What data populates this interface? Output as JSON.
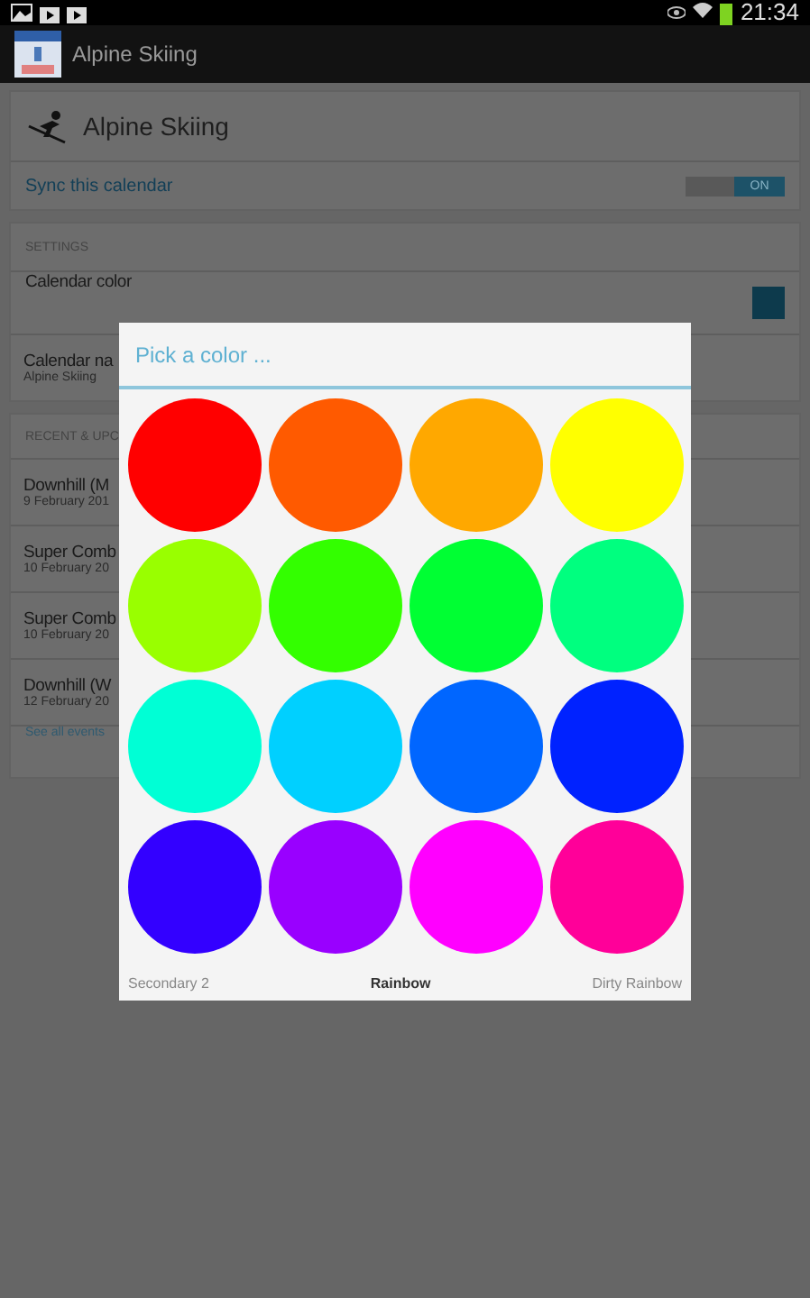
{
  "status_bar": {
    "time": "21:34"
  },
  "action_bar": {
    "title": "Alpine Skiing"
  },
  "calendar_card": {
    "title": "Alpine Skiing",
    "sync_label": "Sync this calendar",
    "sync_toggle": {
      "label": "ON",
      "on": true
    }
  },
  "settings": {
    "header": "SETTINGS",
    "color_label": "Calendar color",
    "color": "#0d3a4c",
    "name_label": "Calendar na",
    "name_value": "Alpine Skiing"
  },
  "events": {
    "header": "RECENT & UPC",
    "items": [
      {
        "title": "Downhill (M",
        "date": "9 February 201"
      },
      {
        "title": "Super Comb",
        "date": "10 February 20"
      },
      {
        "title": "Super Comb",
        "date": "10 February 20"
      },
      {
        "title": "Downhill (W",
        "date": "12 February 20"
      }
    ],
    "see_all": "See all events"
  },
  "dialog": {
    "title": "Pick a color ...",
    "swatches": [
      {
        "color": "#ff0000"
      },
      {
        "color": "#ff5a00"
      },
      {
        "color": "#ffa800"
      },
      {
        "color": "#ffff00"
      },
      {
        "color": "#99ff00"
      },
      {
        "color": "#33ff00"
      },
      {
        "color": "#00ff33"
      },
      {
        "color": "#00ff7f"
      },
      {
        "color": "#00ffd5"
      },
      {
        "color": "#00d0ff"
      },
      {
        "color": "#0066ff"
      },
      {
        "color": "#0022ff"
      },
      {
        "color": "#3300ff"
      },
      {
        "color": "#9900ff"
      },
      {
        "color": "#ff00ff"
      },
      {
        "color": "#ff0099"
      }
    ],
    "palettes": [
      {
        "label": "Secondary 2",
        "selected": false
      },
      {
        "label": "Rainbow",
        "selected": true
      },
      {
        "label": "Dirty Rainbow",
        "selected": false
      }
    ]
  }
}
